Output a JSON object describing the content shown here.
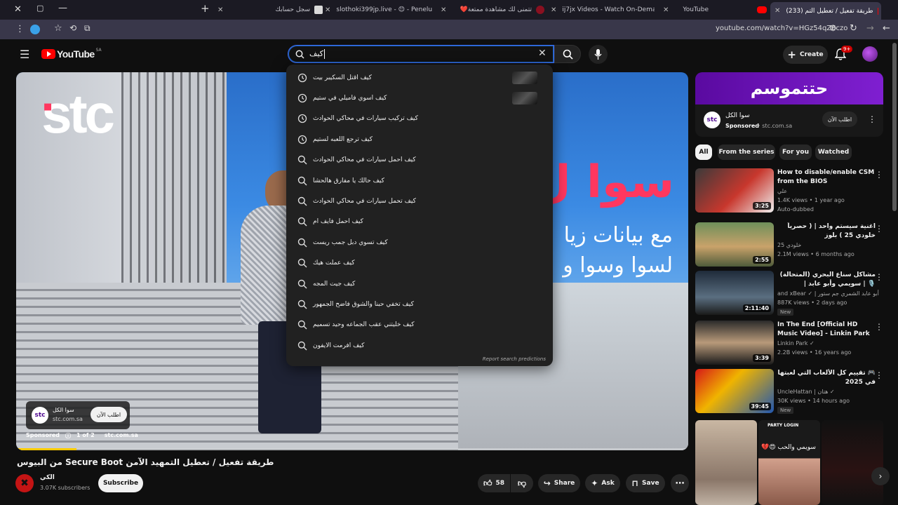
{
  "browser": {
    "tabs": [
      {
        "label": "سجل حسابك",
        "active": false
      },
      {
        "label": "slothoki399jp.live - 😊 - Penelu",
        "active": false
      },
      {
        "label": "❤️تتمنى لك مشاهدة ممتعة",
        "active": false
      },
      {
        "label": "ij7jx Videos - Watch On-Deman",
        "active": false
      },
      {
        "label": "YouTube",
        "active": false
      },
      {
        "label": "(233) طريقة تفعيل / تعطيل التم",
        "active": true
      }
    ],
    "new_tab": "+",
    "url": "youtube.com/watch?v=HGz54qZ6czo"
  },
  "masthead": {
    "logo_text": "YouTube",
    "region": "SA",
    "search_value": "كيف",
    "create_label": "Create",
    "notif_count": "9+"
  },
  "suggestions": {
    "items": [
      {
        "text": "كيف اقتل السكيبر بيت",
        "type": "history",
        "thumb": true
      },
      {
        "text": "كيف اسوي فاميلي في ستيم",
        "type": "history",
        "thumb": true
      },
      {
        "text": "كيف تركيب سيارات في محاكي الحوادث",
        "type": "history",
        "thumb": false
      },
      {
        "text": "كيف ترجع اللعبه لستيم",
        "type": "history",
        "thumb": false
      },
      {
        "text": "كيف احمل سيارات في محاكي الحوادث",
        "type": "search",
        "thumb": false
      },
      {
        "text": "كيف حالك يا مفارق هالحشا",
        "type": "search",
        "thumb": false
      },
      {
        "text": "كيف تحمل سيارات في محاكي الحوادث",
        "type": "search",
        "thumb": false
      },
      {
        "text": "كيف احمل فايف ام",
        "type": "search",
        "thumb": false
      },
      {
        "text": "كيف تسوي دبل جمب ريست",
        "type": "search",
        "thumb": false
      },
      {
        "text": "كيف عملت هيك",
        "type": "search",
        "thumb": false
      },
      {
        "text": "كيف جيت المجه",
        "type": "search",
        "thumb": false
      },
      {
        "text": "كيف تخفي حبنا والشوق فاضح الجمهور",
        "type": "search",
        "thumb": false
      },
      {
        "text": "كيف خليتني عقب الجماعه وحيد تسميم",
        "type": "search",
        "thumb": false
      },
      {
        "text": "كيف افرمت الايفون",
        "type": "search",
        "thumb": false
      }
    ],
    "report_label": "Report search predictions"
  },
  "player": {
    "ad_brand_logo": "stc",
    "ad_headline_1": "سوا ل",
    "ad_headline_2": "مع بيانات زيا",
    "ad_headline_3": "لسوا وسوا و",
    "ad_card_title": "سوا الكل",
    "ad_card_domain": "stc.com.sa",
    "ad_card_cta": "اطلب الآن",
    "sponsored_label": "Sponsored",
    "ad_count": "1 of 2",
    "ad_domain": "stc.com.sa",
    "progress": 0.09
  },
  "video": {
    "title": "طريقة تفعيل / تعطيل التمهيد الآمن Secure Boot من البيوس",
    "channel_name": "الكي",
    "subscribers": "3.07K subscribers",
    "subscribe_label": "Subscribe",
    "likes": "58",
    "share_label": "Share",
    "ask_label": "Ask",
    "save_label": "Save"
  },
  "sidebar": {
    "ad_banner_text": "حتتموسم",
    "ad_title": "سوا الكل",
    "ad_sponsored": "Sponsored",
    "ad_domain": "stc.com.sa",
    "ad_cta": "اطلب الآن",
    "chips": [
      "All",
      "From the series",
      "For you",
      "Watched"
    ],
    "recs": [
      {
        "title": "How to disable/enable CSM from the BIOS",
        "channel": "علي",
        "meta": "1.4K views • 1 year ago",
        "extra": "Auto-dubbed",
        "duration": "3:25",
        "new": false
      },
      {
        "title": "اغنية سيستم واحد | ( حصرياً خلودي 25 ) بلوز",
        "channel": "خلودي 25",
        "meta": "2.1M views • 6 months ago",
        "extra": "",
        "duration": "2:55",
        "new": false
      },
      {
        "title": "مشاكل سناع البحري (المتحالة) 🎙️ | سويمي وأبو عابد | بودكاست بصير خير",
        "channel": "and xBear ✓ | أبو عابد الشمري جم ستور",
        "meta": "887K views • 2 days ago",
        "extra": "",
        "duration": "2:11:40",
        "new": true
      },
      {
        "title": "In The End [Official HD Music Video] - Linkin Park",
        "channel": "Linkin Park ✓",
        "meta": "2.2B views • 16 years ago",
        "extra": "",
        "duration": "3:39",
        "new": false
      },
      {
        "title": "🎮 تقييم كل الألعاب التي لعبتها في 2025",
        "channel": "UncleHattan | هتان ✓",
        "meta": "30K views • 14 hours ago",
        "extra": "",
        "duration": "39:45",
        "new": true
      }
    ],
    "shorts_caption": "سويمي والحب 😍💔",
    "shorts_tag": "PARTY LOGIN"
  },
  "colors": {
    "accent_red": "#ff0000",
    "stc_purple": "#4f0890",
    "ad_red": "#ff375f",
    "search_focus": "#3d6df2"
  }
}
